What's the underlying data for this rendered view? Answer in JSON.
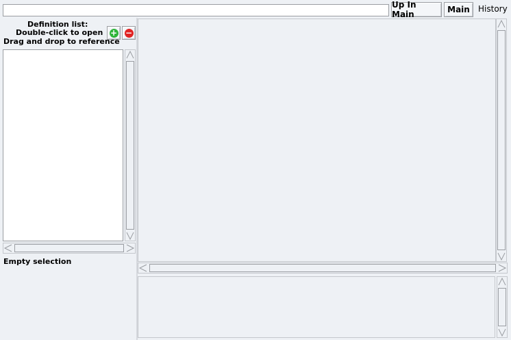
{
  "toolbar": {
    "address_value": "",
    "up_in_main_label": "Up In Main",
    "main_label": "Main",
    "history_label": "History"
  },
  "left_panel": {
    "header_line1": "Definition list:",
    "header_line2": "Double-click to open",
    "header_line3": "Drag and drop to reference",
    "add_icon": "plus-circle-icon",
    "remove_icon": "minus-circle-icon",
    "list_items": [],
    "status_text": "Empty selection"
  },
  "colors": {
    "background": "#eef1f5",
    "add": "#2fb43a",
    "remove": "#e02424"
  }
}
